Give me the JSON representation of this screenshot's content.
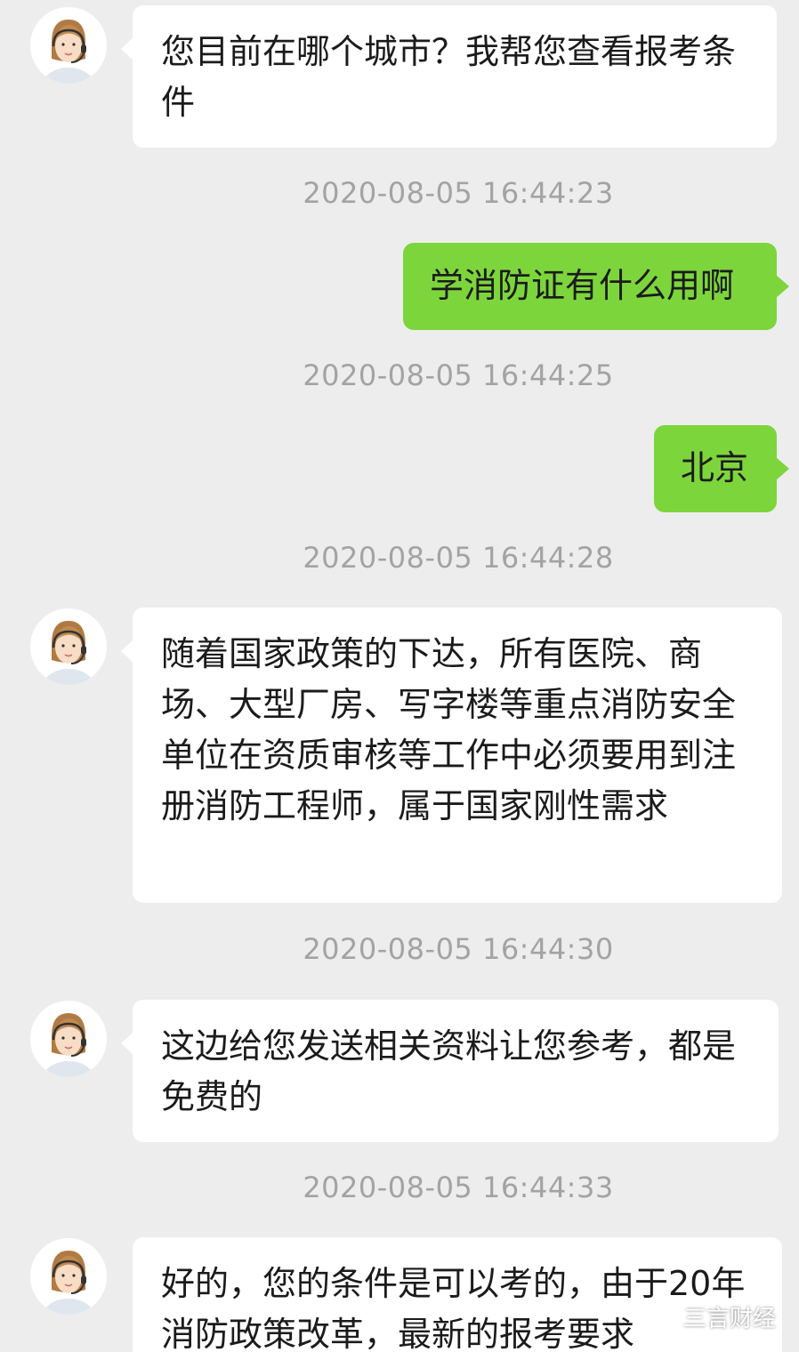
{
  "chat": {
    "messages": [
      {
        "side": "left",
        "text": "您目前在哪个城市？我帮您查看报考条件"
      },
      {
        "time": "2020-08-05 16:44:23"
      },
      {
        "side": "right",
        "text": "学消防证有什么用啊"
      },
      {
        "time": "2020-08-05 16:44:25"
      },
      {
        "side": "right",
        "text": "北京"
      },
      {
        "time": "2020-08-05 16:44:28"
      },
      {
        "side": "left",
        "text": "随着国家政策的下达，所有医院、商场、大型厂房、写字楼等重点消防安全单位在资质审核等工作中必须要用到注册消防工程师，属于国家刚性需求"
      },
      {
        "time": "2020-08-05 16:44:30"
      },
      {
        "side": "left",
        "text": "这边给您发送相关资料让您参考，都是免费的"
      },
      {
        "time": "2020-08-05 16:44:33"
      },
      {
        "side": "left",
        "text": "好的，您的条件是可以考的，由于20年消防政策改革，最新的报考要求"
      }
    ]
  },
  "watermark": {
    "text": "三言财经",
    "icon": "wechat-icon"
  },
  "colors": {
    "background": "#ededed",
    "left_bubble": "#ffffff",
    "right_bubble": "#7dd53c",
    "timestamp": "#a3a3a3"
  }
}
